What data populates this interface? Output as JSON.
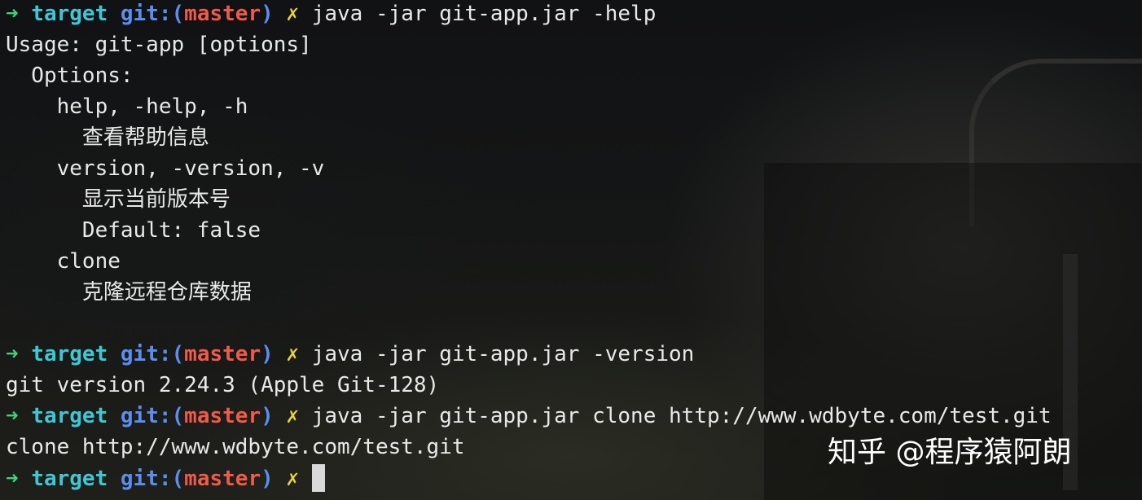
{
  "prompt": {
    "arrow": "➜",
    "dir": "target",
    "git_prefix": "git:(",
    "branch": "master",
    "git_suffix": ")",
    "dirty_mark": "✗"
  },
  "session": [
    {
      "type": "prompt",
      "command": "java -jar git-app.jar -help"
    },
    {
      "type": "output",
      "text": "Usage: git-app [options]"
    },
    {
      "type": "output",
      "text": "  Options:"
    },
    {
      "type": "output",
      "text": "    help, -help, -h"
    },
    {
      "type": "output",
      "text": "      查看帮助信息"
    },
    {
      "type": "output",
      "text": "    version, -version, -v"
    },
    {
      "type": "output",
      "text": "      显示当前版本号"
    },
    {
      "type": "output",
      "text": "      Default: false"
    },
    {
      "type": "output",
      "text": "    clone"
    },
    {
      "type": "output",
      "text": "      克隆远程仓库数据"
    },
    {
      "type": "output",
      "text": ""
    },
    {
      "type": "prompt",
      "command": "java -jar git-app.jar -version"
    },
    {
      "type": "output",
      "text": "git version 2.24.3 (Apple Git-128)"
    },
    {
      "type": "prompt",
      "command": "java -jar git-app.jar clone http://www.wdbyte.com/test.git"
    },
    {
      "type": "output",
      "text": "clone http://www.wdbyte.com/test.git"
    },
    {
      "type": "prompt",
      "command": "",
      "cursor": true
    }
  ],
  "watermark": "知乎 @程序猿阿朗",
  "colors": {
    "arrow": "#3fd27a",
    "dir": "#3fc7d3",
    "git": "#5b8ef0",
    "branch": "#ef5a4a",
    "dirty": "#e7d244",
    "text": "#e9e9e9"
  }
}
